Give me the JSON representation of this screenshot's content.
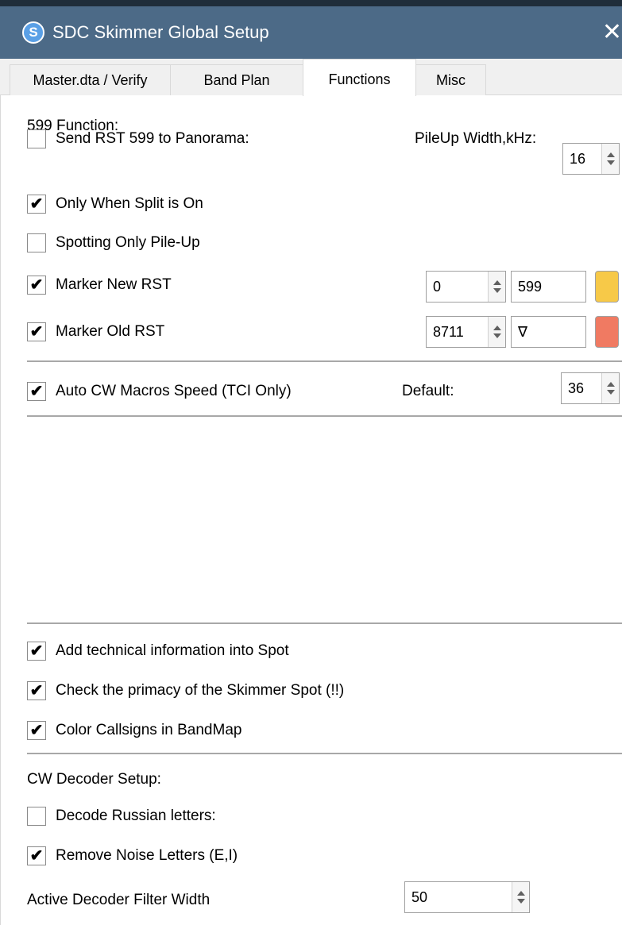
{
  "window": {
    "title": "SDC Skimmer Global Setup",
    "app_icon_glyph": "S",
    "close_glyph": "✕"
  },
  "tabs": [
    {
      "label": "Master.dta / Verify",
      "active": false
    },
    {
      "label": "Band Plan",
      "active": false
    },
    {
      "label": "Functions",
      "active": true
    },
    {
      "label": "Misc",
      "active": false
    }
  ],
  "f599": {
    "heading": "599 Function:",
    "send_rst": {
      "label": "Send RST 599 to Panorama:",
      "checked": false
    },
    "pileup_width": {
      "label": "PileUp Width,kHz:",
      "value": "16"
    },
    "only_split": {
      "label": "Only When Split is On",
      "checked": true
    },
    "spotting_pileup": {
      "label": "Spotting Only Pile-Up",
      "checked": false
    },
    "marker_new": {
      "label": "Marker New RST",
      "checked": true,
      "spin_value": "0",
      "text_value": "599",
      "color": "#f7c948"
    },
    "marker_old": {
      "label": "Marker Old RST",
      "checked": true,
      "spin_value": "8711",
      "text_value": "∇",
      "color": "#f07a62"
    }
  },
  "cw_macros": {
    "label": "Auto CW Macros Speed (TCI Only)",
    "checked": true,
    "default_label": "Default:",
    "default_value": "36"
  },
  "spot_options": {
    "technical_info": {
      "label": "Add technical information into Spot",
      "checked": true
    },
    "primacy": {
      "label": "Check the primacy of the Skimmer Spot (!!)",
      "checked": true
    },
    "color_callsigns": {
      "label": "Color Callsigns in BandMap",
      "checked": true
    }
  },
  "cw_decoder": {
    "heading": "CW Decoder Setup:",
    "russian": {
      "label": "Decode Russian letters:",
      "checked": false
    },
    "noise": {
      "label": "Remove Noise Letters (E,I)",
      "checked": true
    },
    "filter_width": {
      "label": "Active Decoder Filter Width",
      "value": "50"
    }
  },
  "check_glyph": "✔"
}
